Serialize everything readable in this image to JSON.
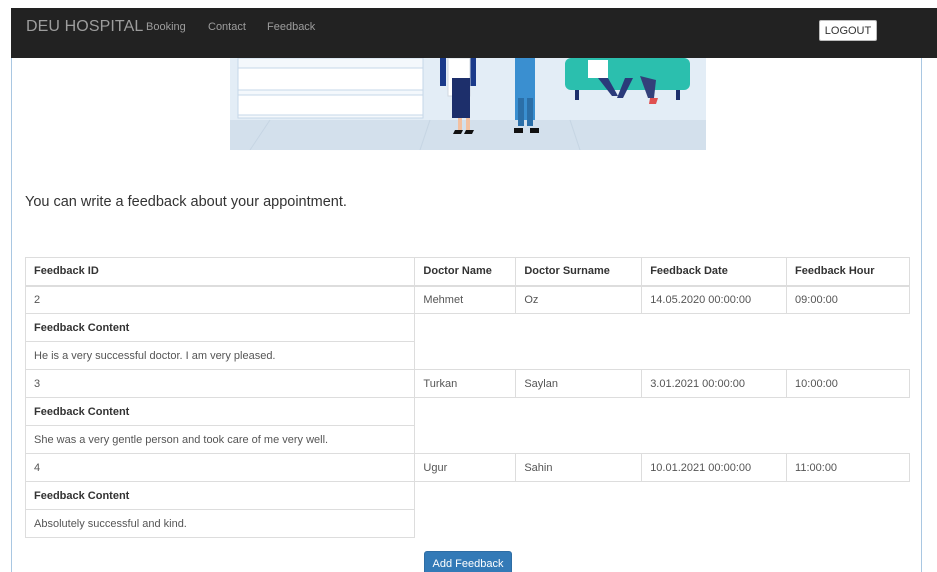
{
  "navbar": {
    "brand": "DEU HOSPITAL",
    "links": [
      "Booking",
      "Contact",
      "Feedback"
    ],
    "logout": "LOGOUT"
  },
  "intro": "You can write a feedback about your appointment.",
  "table": {
    "headers": [
      "Feedback ID",
      "Doctor Name",
      "Doctor Surname",
      "Feedback Date",
      "Feedback Hour"
    ],
    "content_label": "Feedback Content",
    "rows": [
      {
        "id": "2",
        "doctor_name": "Mehmet",
        "doctor_surname": "Oz",
        "date": "14.05.2020 00:00:00",
        "hour": "09:00:00",
        "content": "He is a very successful doctor. I am very pleased."
      },
      {
        "id": "3",
        "doctor_name": "Turkan",
        "doctor_surname": "Saylan",
        "date": "3.01.2021 00:00:00",
        "hour": "10:00:00",
        "content": "She was a very gentle person and took care of me very well."
      },
      {
        "id": "4",
        "doctor_name": "Ugur",
        "doctor_surname": "Sahin",
        "date": "10.01.2021 00:00:00",
        "hour": "11:00:00",
        "content": "Absolutely successful and kind."
      }
    ]
  },
  "add_button": "Add Feedback",
  "colors": {
    "navbar": "#222222",
    "primary": "#337ab7",
    "illustration_bg": "#dde8f3",
    "illustration_accent": "#2bbfae"
  }
}
